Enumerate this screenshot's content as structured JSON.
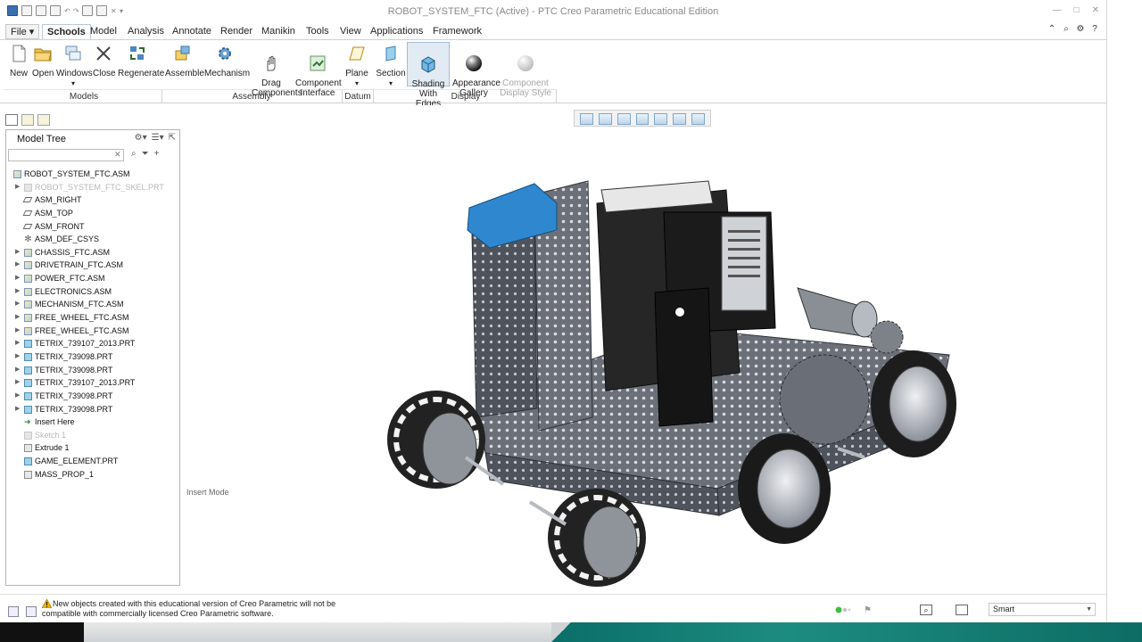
{
  "window": {
    "title": "ROBOT_SYSTEM_FTC (Active) - PTC Creo Parametric Educational Edition"
  },
  "menu": {
    "tabs": [
      "File",
      "Schools",
      "Model",
      "Analysis",
      "Annotate",
      "Render",
      "Manikin",
      "Tools",
      "View",
      "Applications",
      "Framework"
    ],
    "active": "Schools"
  },
  "ribbon": {
    "buttons": {
      "new": "New",
      "open": "Open",
      "windows": "Windows",
      "close": "Close",
      "regenerate": "Regenerate",
      "assemble": "Assemble",
      "mechanism": "Mechanism",
      "drag_components": "Drag\nComponents",
      "component_interface": "Component\nInterface",
      "plane": "Plane",
      "section": "Section",
      "shading": "Shading\nWith Edges",
      "appearance": "Appearance\nGallery",
      "component_display": "Component\nDisplay Style"
    },
    "groups": {
      "models": "Models",
      "assembly": "Assembly",
      "datum": "Datum",
      "display": "Display"
    }
  },
  "model_tree": {
    "title": "Model Tree",
    "items": [
      {
        "label": "ROBOT_SYSTEM_FTC.ASM",
        "icon": "assembly-icon",
        "expandable": false,
        "indent": 0,
        "disabled": false
      },
      {
        "label": "ROBOT_SYSTEM_FTC_SKEL.PRT",
        "icon": "skeleton-part-icon",
        "expandable": true,
        "indent": 1,
        "disabled": true
      },
      {
        "label": "ASM_RIGHT",
        "icon": "datum-plane-icon",
        "expandable": false,
        "indent": 1,
        "disabled": false
      },
      {
        "label": "ASM_TOP",
        "icon": "datum-plane-icon",
        "expandable": false,
        "indent": 1,
        "disabled": false
      },
      {
        "label": "ASM_FRONT",
        "icon": "datum-plane-icon",
        "expandable": false,
        "indent": 1,
        "disabled": false
      },
      {
        "label": "ASM_DEF_CSYS",
        "icon": "coordinate-system-icon",
        "expandable": false,
        "indent": 1,
        "disabled": false
      },
      {
        "label": "CHASSIS_FTC.ASM",
        "icon": "assembly-icon",
        "expandable": true,
        "indent": 1,
        "disabled": false
      },
      {
        "label": "DRIVETRAIN_FTC.ASM",
        "icon": "assembly-icon",
        "expandable": true,
        "indent": 1,
        "disabled": false
      },
      {
        "label": "POWER_FTC.ASM",
        "icon": "assembly-icon",
        "expandable": true,
        "indent": 1,
        "disabled": false
      },
      {
        "label": "ELECTRONICS.ASM",
        "icon": "assembly-icon",
        "expandable": true,
        "indent": 1,
        "disabled": false
      },
      {
        "label": "MECHANISM_FTC.ASM",
        "icon": "assembly-icon",
        "expandable": true,
        "indent": 1,
        "disabled": false
      },
      {
        "label": "FREE_WHEEL_FTC.ASM",
        "icon": "assembly-icon",
        "expandable": true,
        "indent": 1,
        "disabled": false
      },
      {
        "label": "FREE_WHEEL_FTC.ASM",
        "icon": "assembly-icon",
        "expandable": true,
        "indent": 1,
        "disabled": false
      },
      {
        "label": "TETRIX_739107_2013.PRT",
        "icon": "part-icon",
        "expandable": true,
        "indent": 1,
        "disabled": false
      },
      {
        "label": "TETRIX_739098.PRT",
        "icon": "part-icon",
        "expandable": true,
        "indent": 1,
        "disabled": false
      },
      {
        "label": "TETRIX_739098.PRT",
        "icon": "part-icon",
        "expandable": true,
        "indent": 1,
        "disabled": false
      },
      {
        "label": "TETRIX_739107_2013.PRT",
        "icon": "part-icon",
        "expandable": true,
        "indent": 1,
        "disabled": false
      },
      {
        "label": "TETRIX_739098.PRT",
        "icon": "part-icon",
        "expandable": true,
        "indent": 1,
        "disabled": false
      },
      {
        "label": "TETRIX_739098.PRT",
        "icon": "part-icon",
        "expandable": true,
        "indent": 1,
        "disabled": false
      },
      {
        "label": "Insert Here",
        "icon": "insert-arrow-icon",
        "expandable": false,
        "indent": 1,
        "disabled": false
      },
      {
        "label": "Sketch 1",
        "icon": "sketch-icon",
        "expandable": false,
        "indent": 1,
        "disabled": true
      },
      {
        "label": "Extrude 1",
        "icon": "extrude-icon",
        "expandable": false,
        "indent": 1,
        "disabled": false
      },
      {
        "label": "GAME_ELEMENT.PRT",
        "icon": "part-icon",
        "expandable": false,
        "indent": 1,
        "disabled": false
      },
      {
        "label": "MASS_PROP_1",
        "icon": "analysis-feature-icon",
        "expandable": false,
        "indent": 1,
        "disabled": false
      }
    ]
  },
  "viewport": {
    "mode_label": "Insert Mode"
  },
  "status": {
    "message": "New objects created with this educational version of Creo Parametric will not be compatible with commercially licensed Creo Parametric software.",
    "filter": "Smart"
  }
}
